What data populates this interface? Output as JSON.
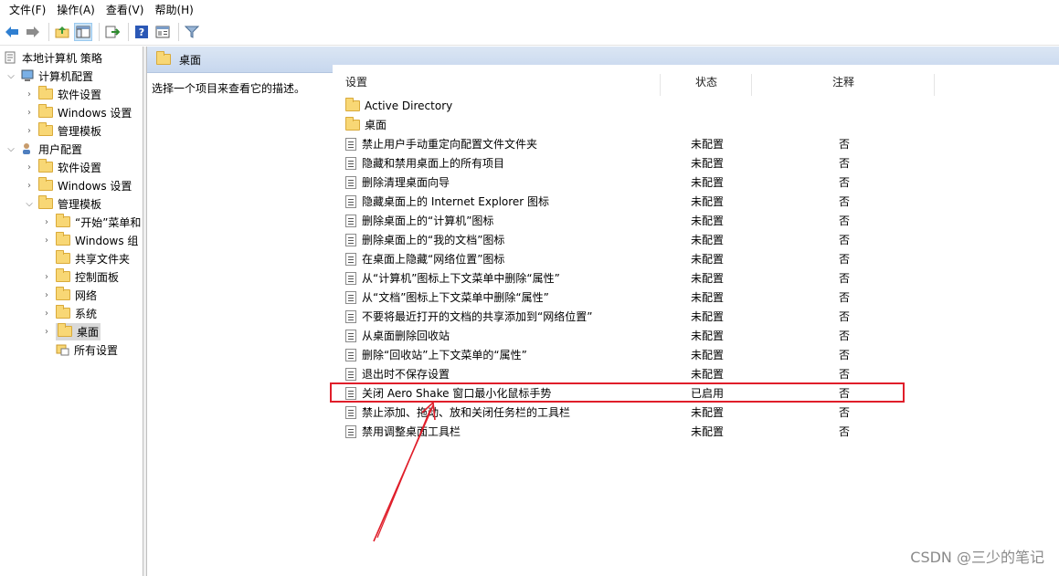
{
  "menu": [
    "文件(F)",
    "操作(A)",
    "查看(V)",
    "帮助(H)"
  ],
  "toolbar": [
    "back-icon",
    "forward-icon",
    "up-folder-icon",
    "show-hide-tree-icon",
    "export-list-icon",
    "help-icon",
    "properties-icon",
    "filter-icon"
  ],
  "tree": {
    "root": "本地计算机 策略",
    "computer": "计算机配置",
    "computer_children": [
      "软件设置",
      "Windows 设置",
      "管理模板"
    ],
    "user": "用户配置",
    "user_children": [
      "软件设置",
      "Windows 设置",
      "管理模板"
    ],
    "admin_children": [
      "“开始”菜单和",
      "Windows 组",
      "共享文件夹",
      "控制面板",
      "网络",
      "系统",
      "桌面",
      "所有设置"
    ]
  },
  "right": {
    "title": "桌面",
    "description": "选择一个项目来查看它的描述。",
    "columns": [
      "设置",
      "状态",
      "注释"
    ],
    "folders": [
      "Active Directory",
      "桌面"
    ],
    "policies": [
      {
        "name": "禁止用户手动重定向配置文件文件夹",
        "state": "未配置",
        "note": "否"
      },
      {
        "name": "隐藏和禁用桌面上的所有项目",
        "state": "未配置",
        "note": "否"
      },
      {
        "name": "删除清理桌面向导",
        "state": "未配置",
        "note": "否"
      },
      {
        "name": "隐藏桌面上的 Internet Explorer 图标",
        "state": "未配置",
        "note": "否"
      },
      {
        "name": "删除桌面上的“计算机”图标",
        "state": "未配置",
        "note": "否"
      },
      {
        "name": "删除桌面上的“我的文档”图标",
        "state": "未配置",
        "note": "否"
      },
      {
        "name": "在桌面上隐藏“网络位置”图标",
        "state": "未配置",
        "note": "否"
      },
      {
        "name": "从“计算机”图标上下文菜单中删除“属性”",
        "state": "未配置",
        "note": "否"
      },
      {
        "name": "从“文档”图标上下文菜单中删除“属性”",
        "state": "未配置",
        "note": "否"
      },
      {
        "name": "不要将最近打开的文档的共享添加到“网络位置”",
        "state": "未配置",
        "note": "否"
      },
      {
        "name": "从桌面删除回收站",
        "state": "未配置",
        "note": "否"
      },
      {
        "name": "删除“回收站”上下文菜单的“属性”",
        "state": "未配置",
        "note": "否"
      },
      {
        "name": "退出时不保存设置",
        "state": "未配置",
        "note": "否"
      },
      {
        "name": "关闭 Aero Shake 窗口最小化鼠标手势",
        "state": "已启用",
        "note": "否"
      },
      {
        "name": "禁止添加、拖动、放和关闭任务栏的工具栏",
        "state": "未配置",
        "note": "否"
      },
      {
        "name": "禁用调整桌面工具栏",
        "state": "未配置",
        "note": "否"
      }
    ]
  },
  "watermark": "CSDN @三少的笔记",
  "colors": {
    "highlight": "#e01e2a",
    "header": "#c7d7ee",
    "folder": "#f8d775"
  }
}
